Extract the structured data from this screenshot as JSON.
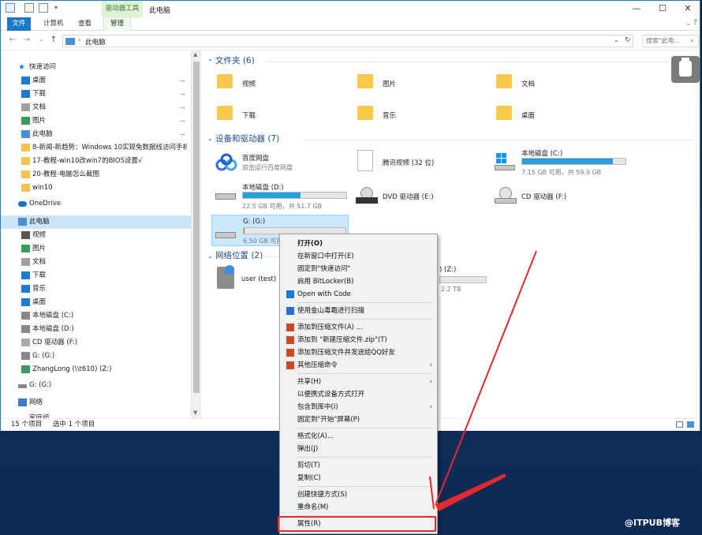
{
  "titlebar": {
    "context_tab": "驱动器工具",
    "title": "此电脑",
    "minimize": "—",
    "maximize": "☐",
    "close": "✕"
  },
  "ribbon": {
    "tabs": [
      "文件",
      "计算机",
      "查看",
      "管理"
    ]
  },
  "address": {
    "path": "此电脑",
    "search_placeholder": "搜索\"此电..."
  },
  "nav": {
    "quick_access": "快速访问",
    "items": [
      {
        "label": "桌面",
        "icon": "desktop-icon",
        "pinned": true
      },
      {
        "label": "下载",
        "icon": "download-icon",
        "pinned": true
      },
      {
        "label": "文档",
        "icon": "documents-icon",
        "pinned": true
      },
      {
        "label": "图片",
        "icon": "pictures-icon",
        "pinned": true
      },
      {
        "label": "此电脑",
        "icon": "pc-icon",
        "pinned": true
      },
      {
        "label": "8-新闻-新趋势：Windows 10实现免数据线访问手机v",
        "icon": "folder-icon"
      },
      {
        "label": "17-教程-win10改win7的BIOS设置√",
        "icon": "folder-icon"
      },
      {
        "label": "20-教程-电脑怎么截图",
        "icon": "folder-icon"
      },
      {
        "label": "win10",
        "icon": "folder-icon"
      }
    ],
    "onedrive": "OneDrive",
    "this_pc": "此电脑",
    "pc_items": [
      "视频",
      "图片",
      "文档",
      "下载",
      "音乐",
      "桌面",
      "本地磁盘 (C:)",
      "本地磁盘 (D:)",
      "CD 驱动器 (F:)",
      "G: (G:)",
      "ZhangLong (\\\\t610) (Z:)"
    ],
    "g_drive": "G: (G:)",
    "network": "网络",
    "homegroup": "家庭组"
  },
  "content": {
    "folders_header": "文件夹 (6)",
    "folders": [
      "视频",
      "图片",
      "文档",
      "下载",
      "音乐",
      "桌面"
    ],
    "devices_header": "设备和驱动器 (7)",
    "baidu": {
      "name": "百度网盘",
      "sub": "双击运行百度网盘"
    },
    "tencent": {
      "name": "腾讯视频 (32 位)"
    },
    "c_drive": {
      "name": "本地磁盘 (C:)",
      "info": "7.15 GB 可用，共 59.9 GB",
      "used_fraction": 0.88
    },
    "d_drive": {
      "name": "本地磁盘 (D:)",
      "info": "22.5 GB 可用，共 51.7 GB",
      "used_fraction": 0.56
    },
    "e_drive": {
      "name": "DVD 驱动器 (E:)"
    },
    "f_drive": {
      "name": "CD 驱动器 (F:)"
    },
    "g_drive": {
      "name": "G: (G:)",
      "info": "6.50 GB 可用",
      "used_fraction": 0.01
    },
    "network_header": "网络位置 (2)",
    "network_user": "user (test)",
    "z_drive_partial": ") (Z:)",
    "z_drive_info": "2.2 TB"
  },
  "status": {
    "count": "15 个项目",
    "selected": "选中 1 个项目"
  },
  "context_menu": {
    "items": [
      {
        "label": "打开(O)",
        "bold": true
      },
      {
        "label": "在新窗口中打开(E)"
      },
      {
        "label": "固定到\"快速访问\""
      },
      {
        "label": "启用 BitLocker(B)"
      },
      {
        "label": "Open with Code",
        "icon": "vscode-icon"
      },
      {
        "sep": true
      },
      {
        "label": "使用金山毒霸进行扫描",
        "icon": "shield-icon"
      },
      {
        "sep": true
      },
      {
        "label": "添加到压缩文件(A) ...",
        "icon": "archive-icon"
      },
      {
        "label": "添加到 \"新建压缩文件.zip\"(T)",
        "icon": "archive-icon"
      },
      {
        "label": "添加到压缩文件并发送给QQ好友",
        "icon": "archive-icon"
      },
      {
        "label": "其他压缩命令",
        "icon": "archive-icon",
        "submenu": true
      },
      {
        "sep": true
      },
      {
        "label": "共享(H)",
        "submenu": true
      },
      {
        "label": "以便携式设备方式打开"
      },
      {
        "label": "包含到库中(I)",
        "submenu": true
      },
      {
        "label": "固定到\"开始\"屏幕(P)"
      },
      {
        "sep": true
      },
      {
        "label": "格式化(A)..."
      },
      {
        "label": "弹出(J)"
      },
      {
        "sep": true
      },
      {
        "label": "剪切(T)"
      },
      {
        "label": "复制(C)"
      },
      {
        "sep": true
      },
      {
        "label": "创建快捷方式(S)"
      },
      {
        "label": "重命名(M)"
      },
      {
        "sep": true
      },
      {
        "label": "属性(R)"
      }
    ]
  },
  "watermark": "@ITPUB博客",
  "colors": {
    "accent": "#1979ca",
    "drive_fill": "#26a0da",
    "highlight": "#e5282d"
  }
}
